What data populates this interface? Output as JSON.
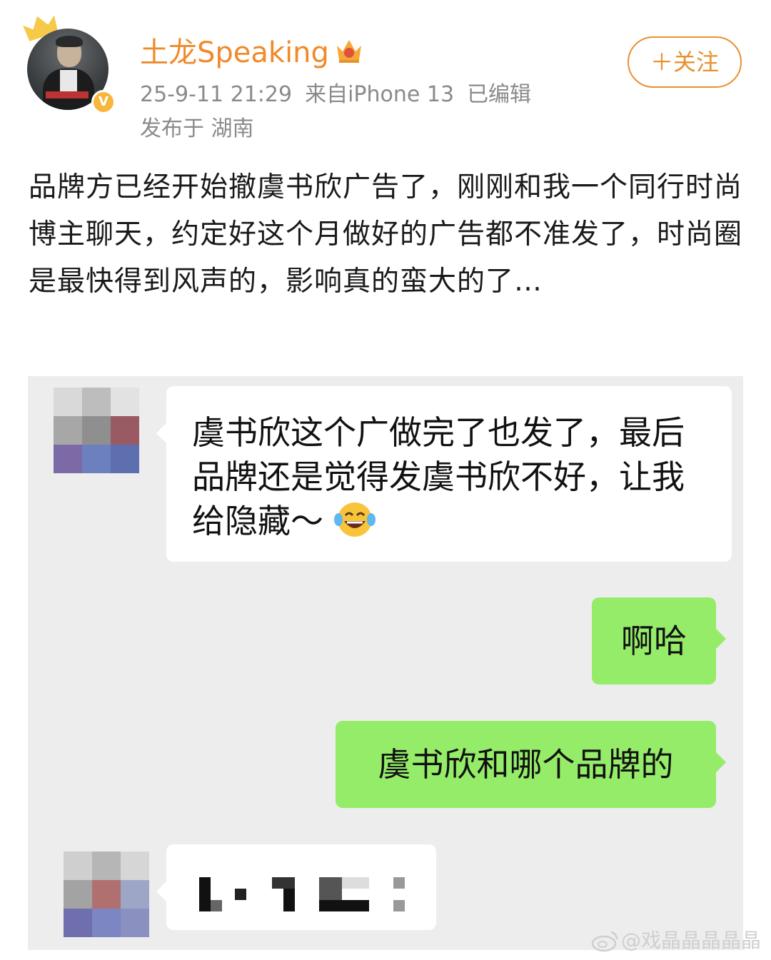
{
  "post": {
    "author": "土龙Speaking",
    "timestamp": "25-9-11 21:29",
    "source": "来自iPhone 13",
    "edited": "已编辑",
    "location": "发布于 湖南",
    "follow_label": "＋关注",
    "text": "品牌方已经开始撤虞书欣广告了，刚刚和我一个同行时尚博主聊天，约定好这个月做好的广告都不准发了，时尚圈是最快得到风声的，影响真的蛮大的了…"
  },
  "chat": {
    "messages": [
      {
        "side": "left",
        "text": "虞书欣这个广做完了也发了，最后品牌还是觉得发虞书欣不好，让我给隐藏～"
      },
      {
        "side": "right",
        "text": "啊哈"
      },
      {
        "side": "right",
        "text": "虞书欣和哪个品牌的"
      },
      {
        "side": "left",
        "text": ""
      }
    ]
  },
  "watermark": "@戏晶晶晶晶晶",
  "icons": {
    "verified": "verified-v-icon",
    "vip": "vip-crown-icon",
    "laugh": "tears-of-joy-emoji-icon",
    "watermark_logo": "weibo-logo-icon"
  },
  "colors": {
    "username": "#f08a2a",
    "follow": "#e8912f",
    "verified": "#f6b73c",
    "green_bubble": "#95ec69",
    "chat_bg": "#ededed"
  }
}
